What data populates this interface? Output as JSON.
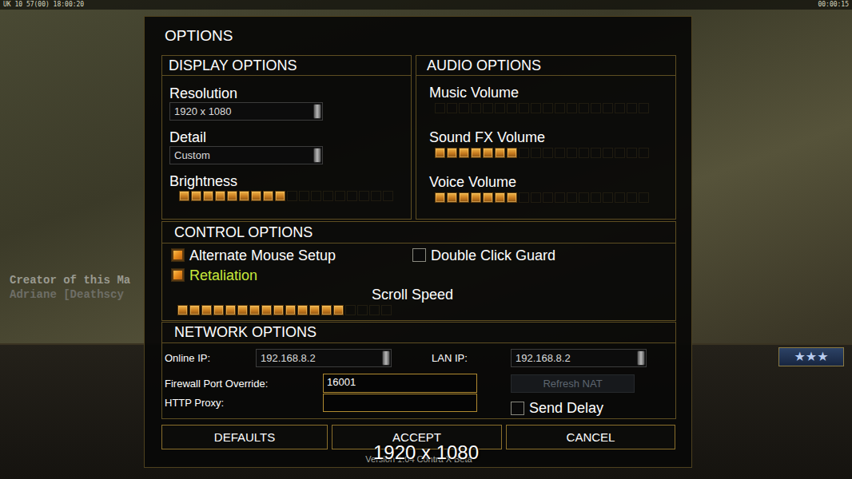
{
  "hud": {
    "top_left": "UK 10 57(00) 18:00:20",
    "top_right": "00:00:15",
    "map_info": [
      "Creator of this Ma",
      "Adriane [Deathscy"
    ],
    "rank": "★★★"
  },
  "dialog": {
    "title": "OPTIONS"
  },
  "display": {
    "title": "DISPLAY OPTIONS",
    "fields": [
      {
        "kind": "dropdown",
        "label": "Resolution",
        "value": "1920 x 1080"
      },
      {
        "kind": "dropdown",
        "label": "Detail",
        "value": "Custom"
      },
      {
        "kind": "slider",
        "label": "Brightness",
        "level": 0.5
      }
    ]
  },
  "audio": {
    "title": "AUDIO OPTIONS",
    "sliders": [
      {
        "label": "Music Volume",
        "level": 0
      },
      {
        "label": "Sound FX Volume",
        "level": 0.39
      },
      {
        "label": "Voice Volume",
        "level": 0.39
      }
    ]
  },
  "controls": {
    "title": "CONTROL OPTIONS",
    "checkboxes": [
      {
        "label": "Alternate Mouse Setup",
        "checked": true,
        "highlighted": false
      },
      {
        "label": "Double Click Guard",
        "checked": false,
        "highlighted": false
      },
      {
        "label": "Retaliation",
        "checked": true,
        "highlighted": true
      }
    ],
    "scroll": {
      "label": "Scroll Speed",
      "level": 0.78
    }
  },
  "network": {
    "title": "NETWORK OPTIONS",
    "online_ip": {
      "label": "Online IP:",
      "value": "192.168.8.2"
    },
    "lan_ip": {
      "label": "LAN IP:",
      "value": "192.168.8.2"
    },
    "firewall": {
      "label": "Firewall Port Override:",
      "value": "16001"
    },
    "proxy": {
      "label": "HTTP Proxy:",
      "value": ""
    },
    "refresh": {
      "label": "Refresh NAT",
      "disabled": true
    },
    "send_delay": {
      "label": "Send Delay",
      "checked": false
    }
  },
  "buttons": [
    {
      "label": "DEFAULTS"
    },
    {
      "label": "ACCEPT"
    },
    {
      "label": "CANCEL"
    }
  ],
  "version": "Version 1.04 Contra X Beta",
  "overlay": "1920 x 1080"
}
